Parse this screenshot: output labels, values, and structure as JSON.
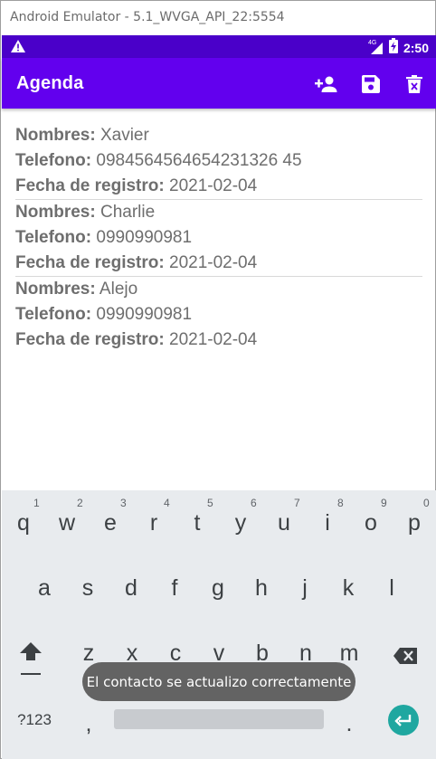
{
  "window": {
    "title": "Android Emulator - 5.1_WVGA_API_22:5554"
  },
  "status_bar": {
    "time": "2:50",
    "network": "4G",
    "icons": [
      "warning-icon",
      "signal-icon",
      "battery-charging-icon"
    ]
  },
  "app_bar": {
    "title": "Agenda",
    "actions": [
      "person-add-icon",
      "save-icon",
      "delete-icon"
    ]
  },
  "labels": {
    "name": "Nombres:",
    "phone": "Telefono:",
    "date": "Fecha de registro:"
  },
  "contacts": [
    {
      "name": "Xavier",
      "phone": "0984564564654231326 45",
      "date": "2021-02-04"
    },
    {
      "name": "Charlie",
      "phone": "0990990981",
      "date": "2021-02-04"
    },
    {
      "name": "Alejo",
      "phone": "0990990981",
      "date": "2021-02-04"
    }
  ],
  "keyboard": {
    "row1": [
      "q",
      "w",
      "e",
      "r",
      "t",
      "y",
      "u",
      "i",
      "o",
      "p"
    ],
    "row1_hints": [
      "1",
      "2",
      "3",
      "4",
      "5",
      "6",
      "7",
      "8",
      "9",
      "0"
    ],
    "row2": [
      "a",
      "s",
      "d",
      "f",
      "g",
      "h",
      "j",
      "k",
      "l"
    ],
    "row3": [
      "z",
      "x",
      "c",
      "v",
      "b",
      "n",
      "m"
    ],
    "symbols": "?123",
    "comma": ",",
    "period": "."
  },
  "toast": {
    "message": "El contacto se actualizo correctamente"
  },
  "colors": {
    "status_bar": "#4a00c9",
    "app_bar": "#6200ee",
    "enter_key": "#1fa7a0"
  }
}
